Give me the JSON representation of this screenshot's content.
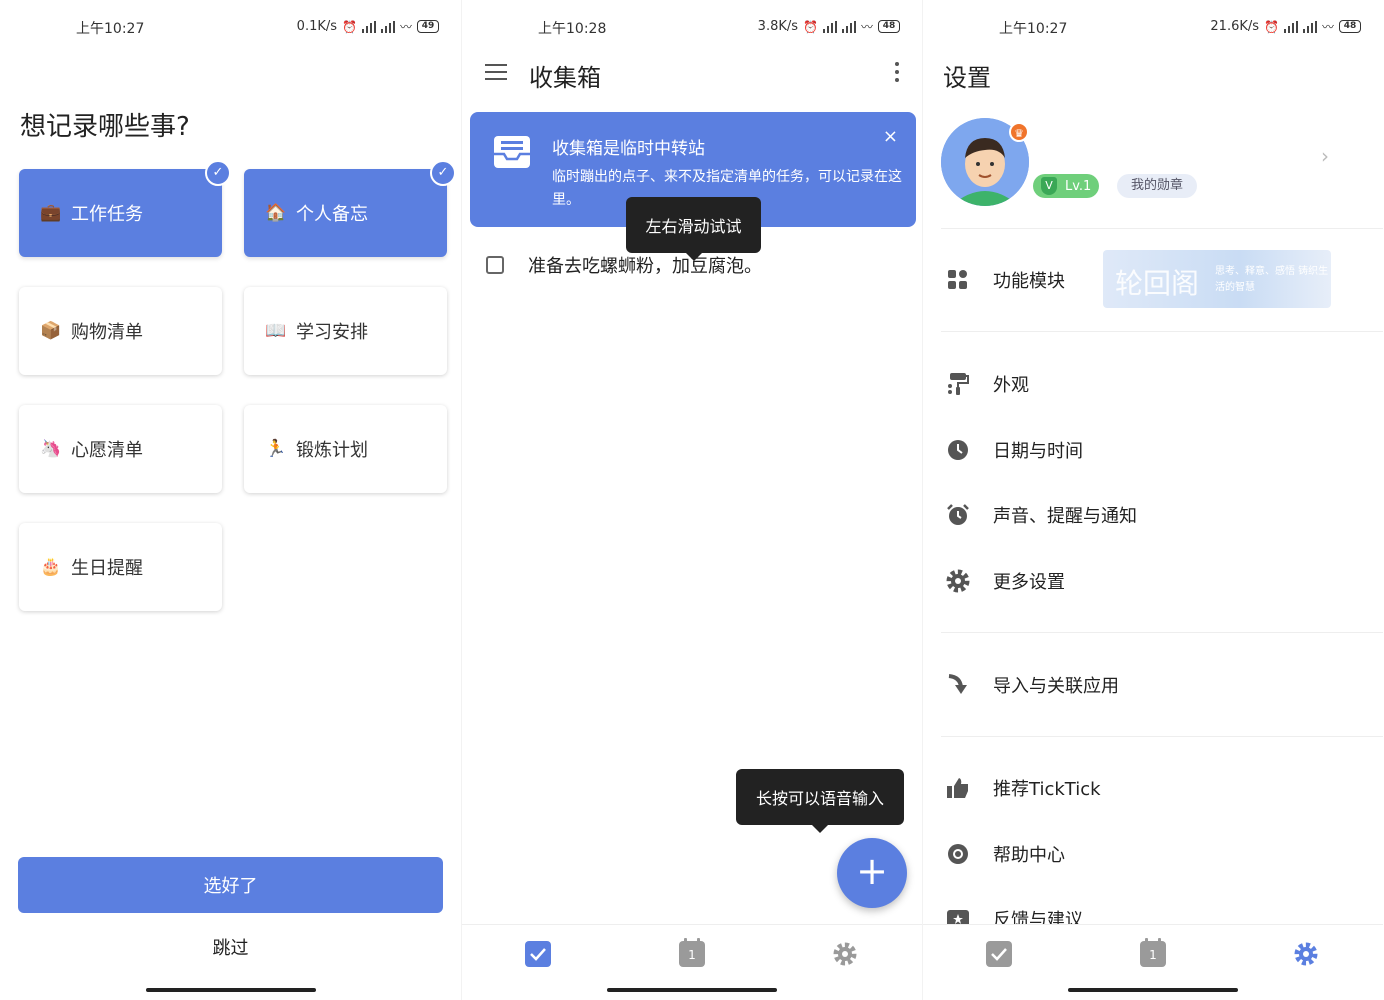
{
  "screens": {
    "onboarding": {
      "status": {
        "time": "上午10:27",
        "speed": "0.1K/s",
        "battery": "49"
      },
      "title": "想记录哪些事?",
      "categories": [
        {
          "label": "工作任务",
          "emoji": "💼",
          "selected": true
        },
        {
          "label": "个人备忘",
          "emoji": "🏠",
          "selected": true
        },
        {
          "label": "购物清单",
          "emoji": "📦",
          "selected": false
        },
        {
          "label": "学习安排",
          "emoji": "📖",
          "selected": false
        },
        {
          "label": "心愿清单",
          "emoji": "🦄",
          "selected": false
        },
        {
          "label": "锻炼计划",
          "emoji": "🏃",
          "selected": false
        },
        {
          "label": "生日提醒",
          "emoji": "🎂",
          "selected": false
        }
      ],
      "confirm_label": "选好了",
      "skip_label": "跳过"
    },
    "inbox": {
      "status": {
        "time": "上午10:28",
        "speed": "3.8K/s",
        "battery": "48"
      },
      "title": "收集箱",
      "banner": {
        "title": "收集箱是临时中转站",
        "description": "临时蹦出的点子、来不及指定清单的任务，可以记录在这里。",
        "close": "×"
      },
      "swipe_tip": "左右滑动试试",
      "task": "准备去吃螺蛳粉，加豆腐泡。",
      "voice_tip": "长按可以语音输入",
      "fab_label": "+",
      "calendar_day": "1"
    },
    "settings": {
      "status": {
        "time": "上午10:27",
        "speed": "21.6K/s",
        "battery": "48"
      },
      "title": "设置",
      "level": "Lv.1",
      "medals": "我的勋章",
      "ad_text": "轮回阁",
      "ad_sub": "思考、释意、感悟 铸织生活的智慧",
      "items": [
        {
          "label": "功能模块",
          "icon": "grid-icon"
        },
        {
          "label": "外观",
          "icon": "paint-roller-icon"
        },
        {
          "label": "日期与时间",
          "icon": "clock-icon"
        },
        {
          "label": "声音、提醒与通知",
          "icon": "alarm-icon"
        },
        {
          "label": "更多设置",
          "icon": "gear-icon"
        },
        {
          "label": "导入与关联应用",
          "icon": "import-arrow-icon"
        },
        {
          "label": "推荐TickTick",
          "icon": "thumbs-up-icon"
        },
        {
          "label": "帮助中心",
          "icon": "lifebuoy-icon"
        },
        {
          "label": "反馈与建议",
          "icon": "feedback-icon"
        }
      ],
      "calendar_day": "1"
    }
  },
  "colors": {
    "accent": "#5b7fe0",
    "icon_gray": "#555555",
    "tab_gray": "#9a9a9a"
  }
}
